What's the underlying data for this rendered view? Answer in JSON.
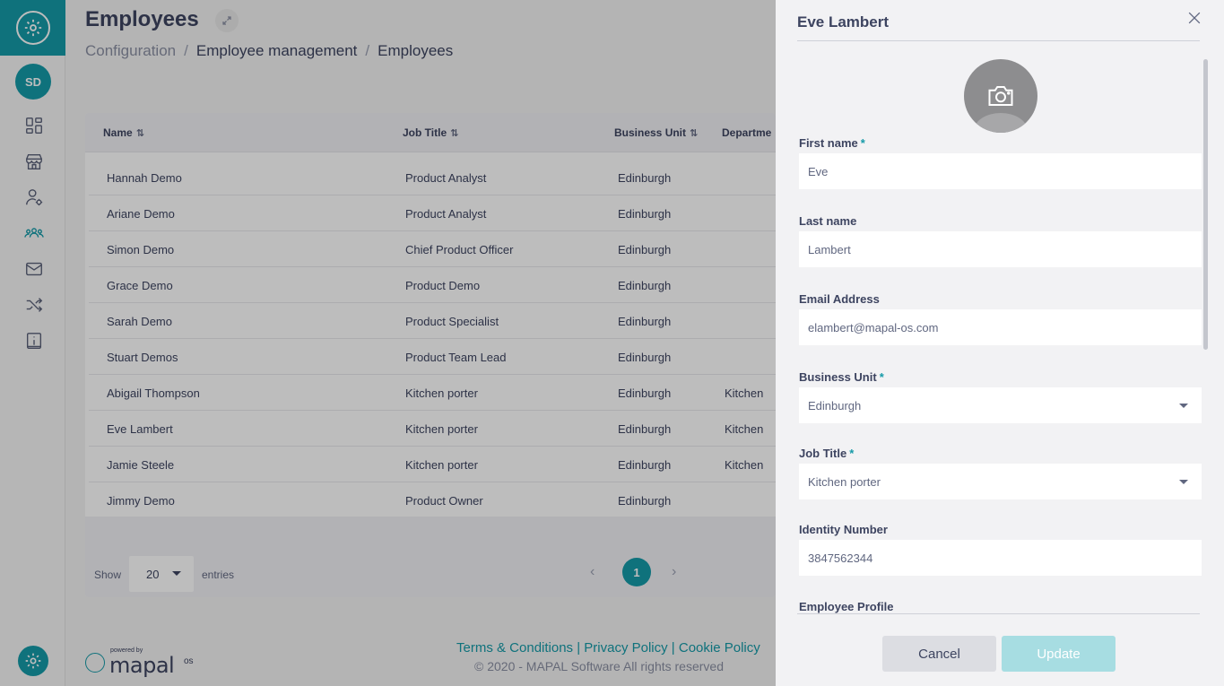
{
  "page": {
    "title": "Employees",
    "breadcrumb": [
      "Configuration",
      "Employee management",
      "Employees"
    ]
  },
  "sidebar": {
    "avatar_initials": "SD",
    "items": [
      "dashboard-icon",
      "store-icon",
      "user-settings-icon",
      "users-group-icon",
      "mail-icon",
      "shuffle-icon",
      "info-icon"
    ],
    "accent_color": "#159aa8"
  },
  "table": {
    "columns": [
      "Name",
      "Job Title",
      "Business Unit",
      "Departme"
    ],
    "rows": [
      {
        "name": "Hannah Demo",
        "job_title": "Product Analyst",
        "business_unit": "Edinburgh",
        "department": ""
      },
      {
        "name": "Ariane Demo",
        "job_title": "Product Analyst",
        "business_unit": "Edinburgh",
        "department": ""
      },
      {
        "name": "Simon Demo",
        "job_title": "Chief Product Officer",
        "business_unit": "Edinburgh",
        "department": ""
      },
      {
        "name": "Grace Demo",
        "job_title": "Product Demo",
        "business_unit": "Edinburgh",
        "department": ""
      },
      {
        "name": "Sarah Demo",
        "job_title": "Product Specialist",
        "business_unit": "Edinburgh",
        "department": ""
      },
      {
        "name": "Stuart Demos",
        "job_title": "Product Team Lead",
        "business_unit": "Edinburgh",
        "department": ""
      },
      {
        "name": "Abigail Thompson",
        "job_title": "Kitchen porter",
        "business_unit": "Edinburgh",
        "department": "Kitchen"
      },
      {
        "name": "Eve Lambert",
        "job_title": "Kitchen porter",
        "business_unit": "Edinburgh",
        "department": "Kitchen"
      },
      {
        "name": "Jamie Steele",
        "job_title": "Kitchen porter",
        "business_unit": "Edinburgh",
        "department": "Kitchen"
      },
      {
        "name": "Jimmy Demo",
        "job_title": "Product Owner",
        "business_unit": "Edinburgh",
        "department": ""
      }
    ],
    "footer": {
      "show_label": "Show",
      "entries_value": "20",
      "entries_label": "entries",
      "current_page": "1"
    }
  },
  "footer": {
    "powered_by": "powered by",
    "brand": "mapal",
    "brand_suffix": "os",
    "links": "Terms & Conditions | Privacy Policy | Cookie Policy",
    "copyright": "© 2020 - MAPAL Software All rights reserved"
  },
  "drawer": {
    "title": "Eve Lambert",
    "fields": {
      "first_name": {
        "label": "First name",
        "required": "*",
        "value": "Eve"
      },
      "last_name": {
        "label": "Last name",
        "value": "Lambert"
      },
      "email": {
        "label": "Email Address",
        "value": "elambert@mapal-os.com"
      },
      "business_unit": {
        "label": "Business Unit",
        "required": "*",
        "value": "Edinburgh"
      },
      "job_title": {
        "label": "Job Title",
        "required": "*",
        "value": "Kitchen porter"
      },
      "identity_number": {
        "label": "Identity Number",
        "value": "3847562344"
      },
      "employee_profile": {
        "label": "Employee Profile"
      }
    },
    "cancel_label": "Cancel",
    "update_label": "Update"
  }
}
